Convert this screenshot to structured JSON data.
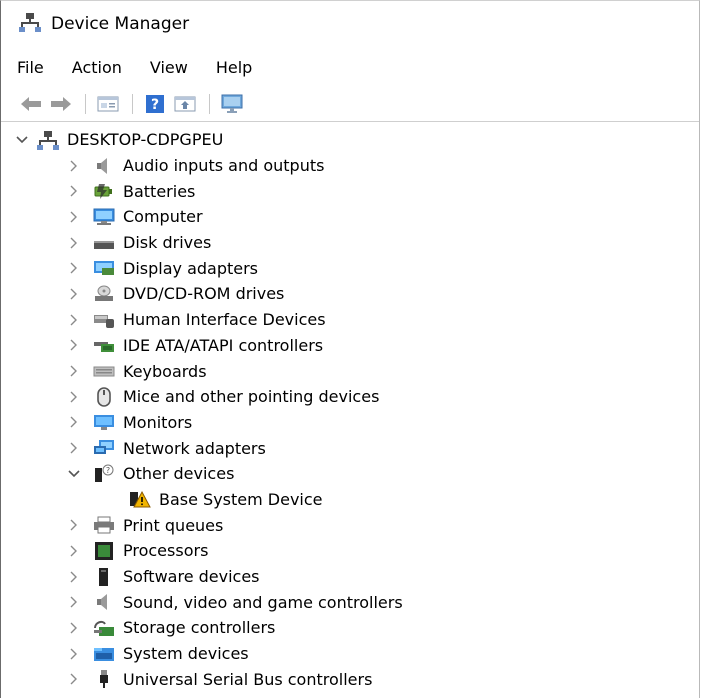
{
  "window": {
    "title": "Device Manager",
    "icon": "device-manager-icon"
  },
  "menu": {
    "items": [
      "File",
      "Action",
      "View",
      "Help"
    ]
  },
  "toolbar": {
    "buttons": [
      "back-arrow-icon",
      "forward-arrow-icon",
      "properties-icon",
      "help-icon",
      "update-driver-icon",
      "monitor-scan-icon"
    ]
  },
  "tree": {
    "root": {
      "label": "DESKTOP-CDPGPEU",
      "expanded": true
    },
    "items": [
      {
        "label": "Audio inputs and outputs",
        "icon": "speaker-icon"
      },
      {
        "label": "Batteries",
        "icon": "battery-icon"
      },
      {
        "label": "Computer",
        "icon": "computer-icon"
      },
      {
        "label": "Disk drives",
        "icon": "disk-drive-icon"
      },
      {
        "label": "Display adapters",
        "icon": "display-adapter-icon"
      },
      {
        "label": "DVD/CD-ROM drives",
        "icon": "dvd-drive-icon"
      },
      {
        "label": "Human Interface Devices",
        "icon": "hid-icon"
      },
      {
        "label": "IDE ATA/ATAPI controllers",
        "icon": "ide-controller-icon"
      },
      {
        "label": "Keyboards",
        "icon": "keyboard-icon"
      },
      {
        "label": "Mice and other pointing devices",
        "icon": "mouse-icon"
      },
      {
        "label": "Monitors",
        "icon": "monitor-icon"
      },
      {
        "label": "Network adapters",
        "icon": "network-adapter-icon"
      },
      {
        "label": "Other devices",
        "icon": "unknown-device-icon",
        "expanded": true,
        "children": [
          {
            "label": "Base System Device",
            "icon": "warning-device-icon"
          }
        ]
      },
      {
        "label": "Print queues",
        "icon": "printer-icon"
      },
      {
        "label": "Processors",
        "icon": "processor-icon"
      },
      {
        "label": "Software devices",
        "icon": "software-device-icon"
      },
      {
        "label": "Sound, video and game controllers",
        "icon": "speaker-icon"
      },
      {
        "label": "Storage controllers",
        "icon": "storage-controller-icon"
      },
      {
        "label": "System devices",
        "icon": "system-folder-icon"
      },
      {
        "label": "Universal Serial Bus controllers",
        "icon": "usb-icon"
      }
    ]
  }
}
